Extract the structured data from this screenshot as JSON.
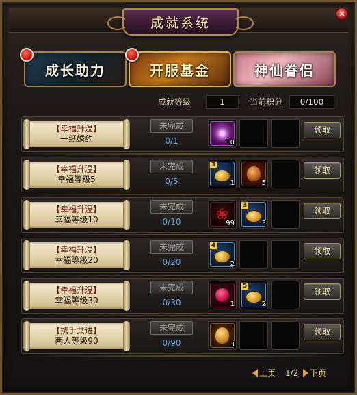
{
  "window": {
    "title": "成就系统",
    "close_label": "×"
  },
  "tabs": [
    {
      "label": "成长助力",
      "has_notification": true
    },
    {
      "label": "开服基金",
      "has_notification": true
    },
    {
      "label": "神仙眷侣",
      "has_notification": false
    }
  ],
  "stats": {
    "level_label": "成就等级",
    "level_value": "1",
    "points_label": "当前积分",
    "points_value": "0/100"
  },
  "achievements": [
    {
      "category": "【幸福升温】",
      "name": "一纸婚约",
      "status": "未完成",
      "progress": "0/1",
      "claim_label": "领取",
      "rewards": [
        {
          "icon": "purple-ring-icon",
          "qty": "10"
        }
      ]
    },
    {
      "category": "【幸福升温】",
      "name": "幸福等级5",
      "status": "未完成",
      "progress": "0/5",
      "claim_label": "领取",
      "rewards": [
        {
          "icon": "gold-coin-icon",
          "tier": "3",
          "qty": "1"
        },
        {
          "icon": "fire-stone-icon",
          "qty": "5"
        }
      ]
    },
    {
      "category": "【幸福升温】",
      "name": "幸福等级10",
      "status": "未完成",
      "progress": "0/10",
      "claim_label": "领取",
      "rewards": [
        {
          "icon": "red-rose-icon",
          "qty": "99"
        },
        {
          "icon": "gold-coin-icon",
          "tier": "3",
          "qty": "3"
        }
      ]
    },
    {
      "category": "【幸福升温】",
      "name": "幸福等级20",
      "status": "未完成",
      "progress": "0/20",
      "claim_label": "领取",
      "rewards": [
        {
          "icon": "gold-coin-icon",
          "tier": "4",
          "qty": "2"
        }
      ]
    },
    {
      "category": "【幸福升温】",
      "name": "幸福等级30",
      "status": "未完成",
      "progress": "0/30",
      "claim_label": "领取",
      "rewards": [
        {
          "icon": "love-fruit-icon",
          "qty": "1"
        },
        {
          "icon": "gold-coin-icon",
          "tier": "5",
          "qty": "2"
        }
      ]
    },
    {
      "category": "【携手共进】",
      "name": "两人等级90",
      "status": "未完成",
      "progress": "0/90",
      "claim_label": "领取",
      "rewards": [
        {
          "icon": "golden-egg-icon",
          "qty": "3"
        }
      ]
    }
  ],
  "pager": {
    "prev_label": "上页",
    "page": "1/2",
    "next_label": "下页"
  }
}
